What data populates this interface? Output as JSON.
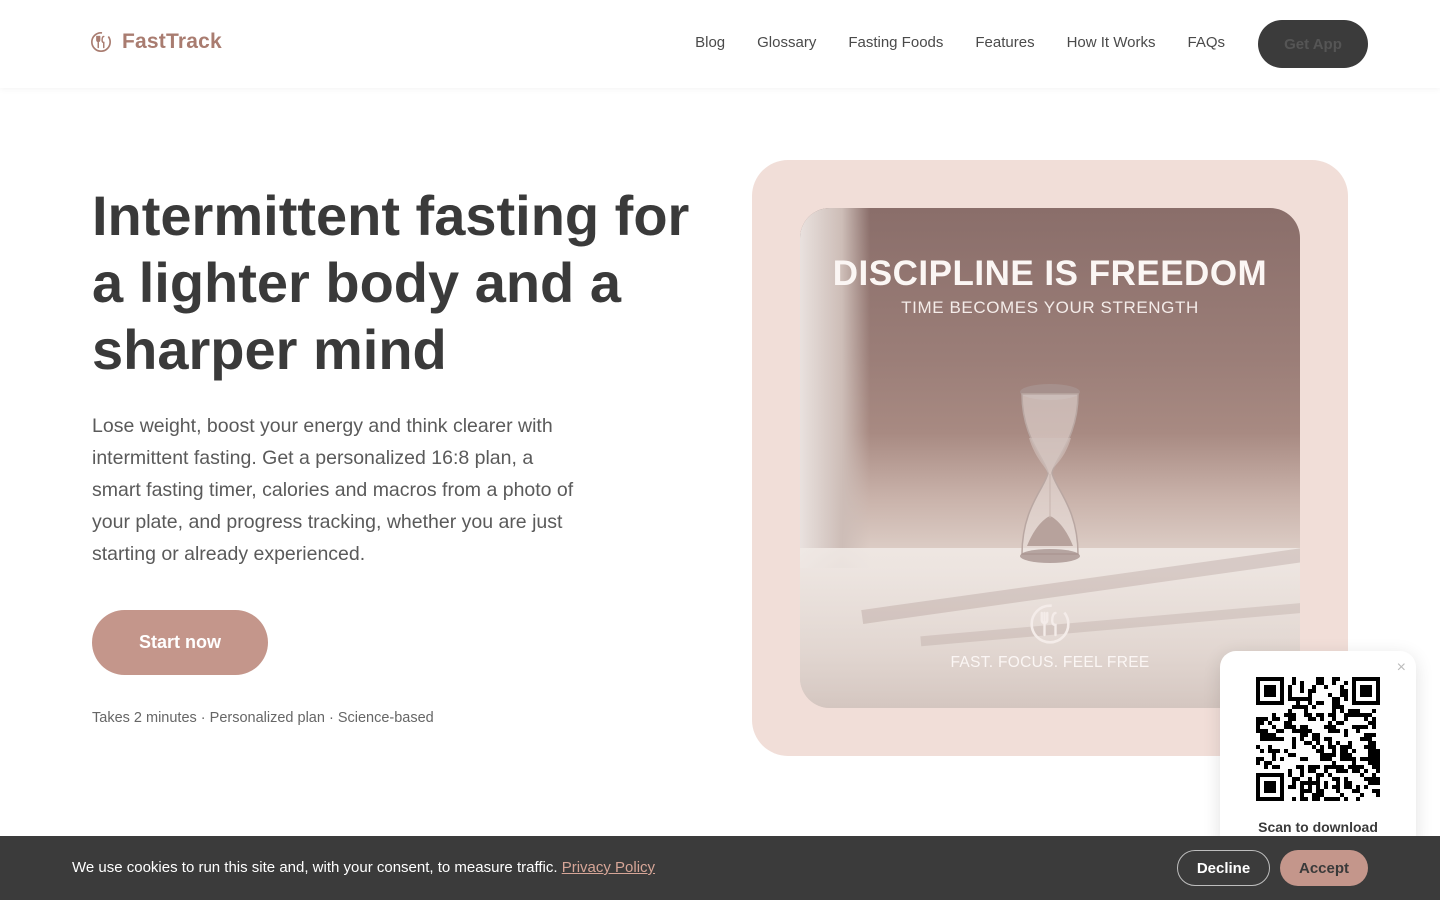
{
  "brand": {
    "name": "FastTrack",
    "color": "#a97c70"
  },
  "nav": {
    "items": [
      "Blog",
      "Glossary",
      "Fasting Foods",
      "Features",
      "How It Works",
      "FAQs"
    ],
    "cta_label": "Get App"
  },
  "hero": {
    "title": "Intermittent fasting for a lighter body and a sharper mind",
    "description": "Lose weight, boost your energy and think clearer with intermittent fasting. Get a personalized 16:8 plan, a smart fasting timer, calories and macros from a photo of your plate, and progress tracking, whether you are just starting or already experienced.",
    "cta_label": "Start now",
    "tagline": "Takes 2 minutes · Personalized plan · Science-based",
    "accent_color": "#c4968b"
  },
  "promo_image": {
    "heading": "DISCIPLINE IS FREEDOM",
    "subheading": "TIME BECOMES YOUR STRENGTH",
    "footer": "FAST. FOCUS. FEEL FREE",
    "card_background": "#f1ded8"
  },
  "qr_popup": {
    "label": "Scan to download",
    "close_icon": "×"
  },
  "cookie_banner": {
    "text": "We use cookies to run this site and, with your consent, to measure traffic.",
    "link_text": "Privacy Policy",
    "decline_label": "Decline",
    "accept_label": "Accept"
  }
}
